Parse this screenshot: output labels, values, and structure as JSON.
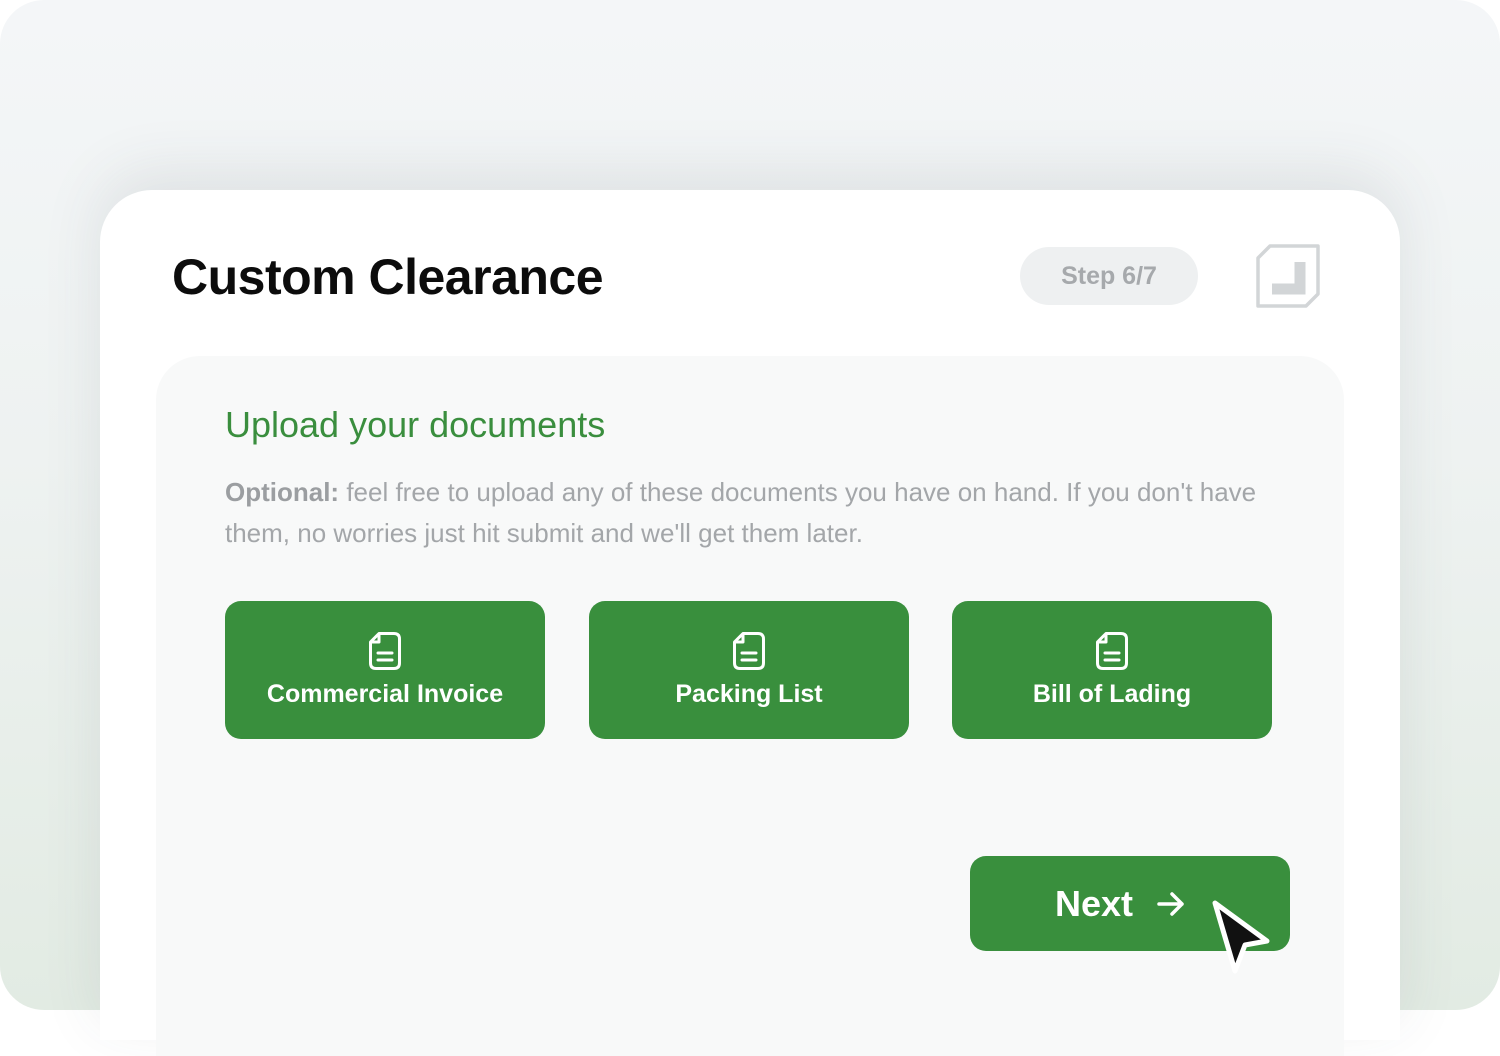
{
  "header": {
    "title": "Custom Clearance",
    "step_label": "Step 6/7",
    "logo_icon": "corner-bracket-logo-icon"
  },
  "upload": {
    "heading": "Upload your documents",
    "description_strong": "Optional:",
    "description_rest": " feel free to upload any of these documents you have on hand. If you don't have them, no worries just hit submit and we'll get them later.",
    "documents": [
      {
        "label": "Commercial Invoice",
        "icon": "document-icon"
      },
      {
        "label": "Packing List",
        "icon": "document-icon"
      },
      {
        "label": "Bill of Lading",
        "icon": "document-icon"
      }
    ]
  },
  "actions": {
    "next_label": "Next",
    "next_icon": "arrow-right-icon"
  },
  "colors": {
    "accent": "#398f3d",
    "heading_green": "#3a8e3e",
    "muted_text": "#a3a6a9",
    "badge_bg": "#eef0f1"
  }
}
